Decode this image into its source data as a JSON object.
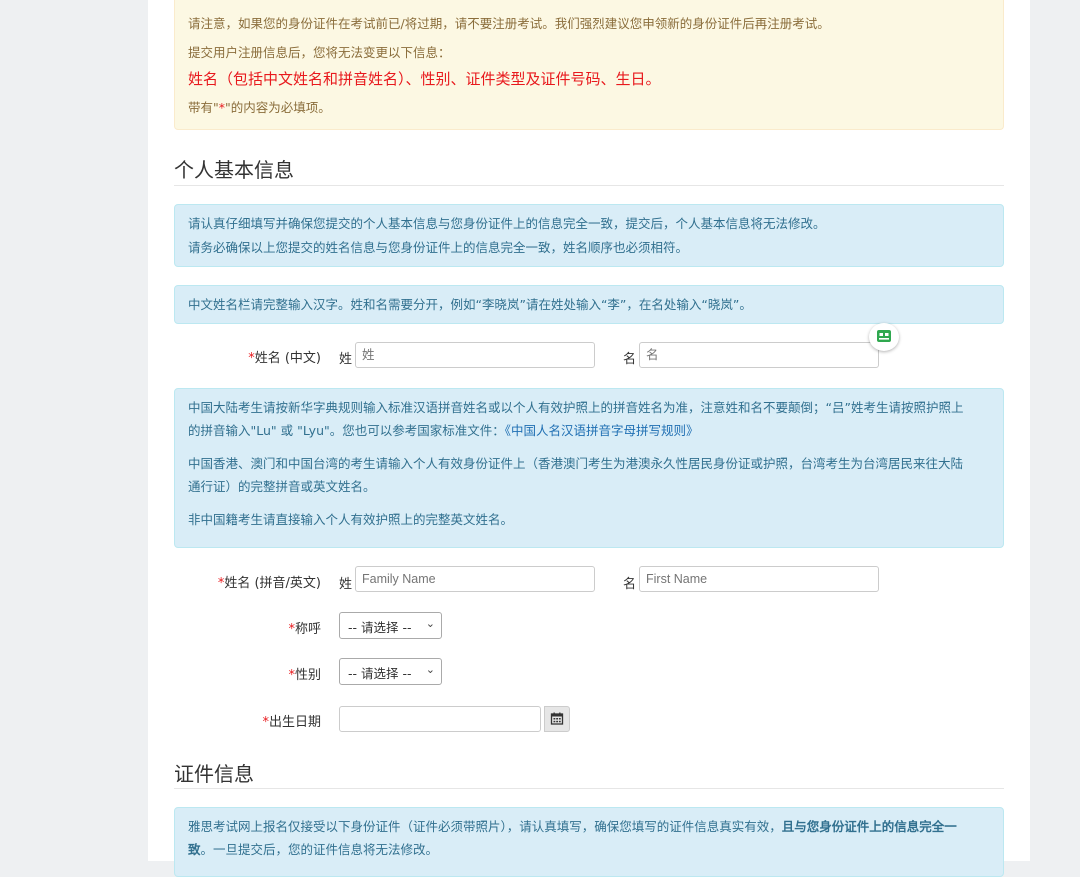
{
  "notice": {
    "line1": "请注意，如果您的身份证件在考试前已/将过期，请不要注册考试。我们强烈建议您申领新的身份证件后再注册考试。",
    "line2": "提交用户注册信息后，您将无法变更以下信息：",
    "line3": "姓名（包括中文姓名和拼音姓名）、性别、证件类型及证件号码、生日。",
    "line4_prefix": "带有\"",
    "line4_star": "*",
    "line4_suffix": "\"的内容为必填项。"
  },
  "section_basic": {
    "title": "个人基本信息",
    "info1_line1": "请认真仔细填写并确保您提交的个人基本信息与您身份证件上的信息完全一致，提交后，个人基本信息将无法修改。",
    "info1_line2": "请务必确保以上您提交的姓名信息与您身份证件上的信息完全一致，姓名顺序也必须相符。",
    "info2": "中文姓名栏请完整输入汉字。姓和名需要分开，例如“李晓岚”请在姓处输入“李”，在名处输入“晓岚”。",
    "cn_name": {
      "req": "*",
      "label": "姓名 (中文)",
      "last_label": "姓",
      "last_placeholder": "姓",
      "first_label": "名",
      "first_placeholder": "名"
    },
    "info3": {
      "p1_text": "中国大陆考生请按新华字典规则输入标准汉语拼音姓名或以个人有效护照上的拼音姓名为准，注意姓和名不要颠倒；“吕”姓考生请按照护照上的拼音输入\"Lu\" 或 \"Lyu\"。您也可以参考国家标准文件：",
      "p1_link": "《中国人名汉语拼音字母拼写规则》",
      "p2": "中国香港、澳门和中国台湾的考生请输入个人有效身份证件上（香港澳门考生为港澳永久性居民身份证或护照，台湾考生为台湾居民来往大陆通行证）的完整拼音或英文姓名。",
      "p3": "非中国籍考生请直接输入个人有效护照上的完整英文姓名。"
    },
    "en_name": {
      "req": "*",
      "label": "姓名 (拼音/英文)",
      "last_label": "姓",
      "last_placeholder": "Family Name",
      "first_label": "名",
      "first_placeholder": "First Name"
    },
    "title_field": {
      "req": "*",
      "label": "称呼",
      "value": "-- 请选择 --"
    },
    "gender_field": {
      "req": "*",
      "label": "性别",
      "value": "-- 请选择 --"
    },
    "dob_field": {
      "req": "*",
      "label": "出生日期",
      "value": ""
    }
  },
  "section_id": {
    "title": "证件信息",
    "info_prefix": "雅思考试网上报名仅接受以下身份证件（证件必须带照片），请认真填写，确保您填写的证件信息真实有效，",
    "info_bold": "且与您身份证件上的信息完全一致",
    "info_suffix": "。一旦提交后，您的证件信息将无法修改。"
  },
  "icons": {
    "calendar": "calendar-icon",
    "robot": "robot-icon",
    "chevron": "chevron-down-icon"
  },
  "colors": {
    "required": "#e8191d",
    "warning_bg": "#fcf8e3",
    "info_bg": "#d9edf7",
    "info_text": "#31708f"
  }
}
